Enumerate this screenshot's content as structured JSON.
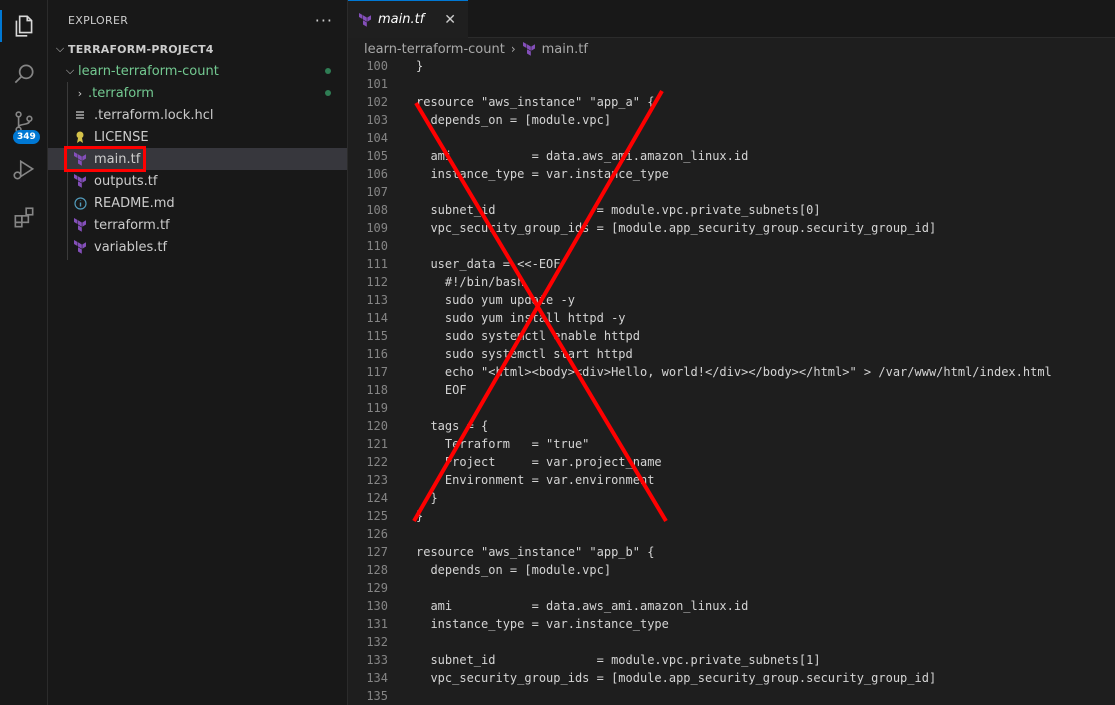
{
  "activity_bar": {
    "source_control_badge": "349"
  },
  "sidebar": {
    "title": "EXPLORER",
    "more_actions": "···",
    "project": "TERRAFORM-PROJECT4",
    "folder": "learn-terraform-count",
    "items": [
      {
        "label": ".terraform",
        "icon": "chevron-right"
      },
      {
        "label": ".terraform.lock.hcl",
        "icon": "lines-icon"
      },
      {
        "label": "LICENSE",
        "icon": "license-icon"
      },
      {
        "label": "main.tf",
        "icon": "terraform-icon"
      },
      {
        "label": "outputs.tf",
        "icon": "terraform-icon"
      },
      {
        "label": "README.md",
        "icon": "info-icon"
      },
      {
        "label": "terraform.tf",
        "icon": "terraform-icon"
      },
      {
        "label": "variables.tf",
        "icon": "terraform-icon"
      }
    ]
  },
  "editor": {
    "tab": {
      "label": "main.tf",
      "close": "✕"
    },
    "breadcrumbs": {
      "folder": "learn-terraform-count",
      "separator": "›",
      "file": "main.tf"
    },
    "lines": [
      {
        "n": "100",
        "t": "}"
      },
      {
        "n": "101",
        "t": ""
      },
      {
        "n": "102",
        "t": "resource \"aws_instance\" \"app_a\" {"
      },
      {
        "n": "103",
        "t": "  depends_on = [module.vpc]"
      },
      {
        "n": "104",
        "t": ""
      },
      {
        "n": "105",
        "t": "  ami           = data.aws_ami.amazon_linux.id"
      },
      {
        "n": "106",
        "t": "  instance_type = var.instance_type"
      },
      {
        "n": "107",
        "t": ""
      },
      {
        "n": "108",
        "t": "  subnet_id              = module.vpc.private_subnets[0]"
      },
      {
        "n": "109",
        "t": "  vpc_security_group_ids = [module.app_security_group.security_group_id]"
      },
      {
        "n": "110",
        "t": ""
      },
      {
        "n": "111",
        "t": "  user_data = <<-EOF"
      },
      {
        "n": "112",
        "t": "    #!/bin/bash"
      },
      {
        "n": "113",
        "t": "    sudo yum update -y"
      },
      {
        "n": "114",
        "t": "    sudo yum install httpd -y"
      },
      {
        "n": "115",
        "t": "    sudo systemctl enable httpd"
      },
      {
        "n": "116",
        "t": "    sudo systemctl start httpd"
      },
      {
        "n": "117",
        "t": "    echo \"<html><body><div>Hello, world!</div></body></html>\" > /var/www/html/index.html"
      },
      {
        "n": "118",
        "t": "    EOF"
      },
      {
        "n": "119",
        "t": ""
      },
      {
        "n": "120",
        "t": "  tags = {"
      },
      {
        "n": "121",
        "t": "    Terraform   = \"true\""
      },
      {
        "n": "122",
        "t": "    Project     = var.project_name"
      },
      {
        "n": "123",
        "t": "    Environment = var.environment"
      },
      {
        "n": "124",
        "t": "  }"
      },
      {
        "n": "125",
        "t": "}"
      },
      {
        "n": "126",
        "t": ""
      },
      {
        "n": "127",
        "t": "resource \"aws_instance\" \"app_b\" {"
      },
      {
        "n": "128",
        "t": "  depends_on = [module.vpc]"
      },
      {
        "n": "129",
        "t": ""
      },
      {
        "n": "130",
        "t": "  ami           = data.aws_ami.amazon_linux.id"
      },
      {
        "n": "131",
        "t": "  instance_type = var.instance_type"
      },
      {
        "n": "132",
        "t": ""
      },
      {
        "n": "133",
        "t": "  subnet_id              = module.vpc.private_subnets[1]"
      },
      {
        "n": "134",
        "t": "  vpc_security_group_ids = [module.app_security_group.security_group_id]"
      },
      {
        "n": "135",
        "t": ""
      }
    ]
  },
  "colors": {
    "accent": "#0078d4",
    "annotation": "#ff0000",
    "terraform": "#844fba",
    "git_added": "#73c991"
  }
}
